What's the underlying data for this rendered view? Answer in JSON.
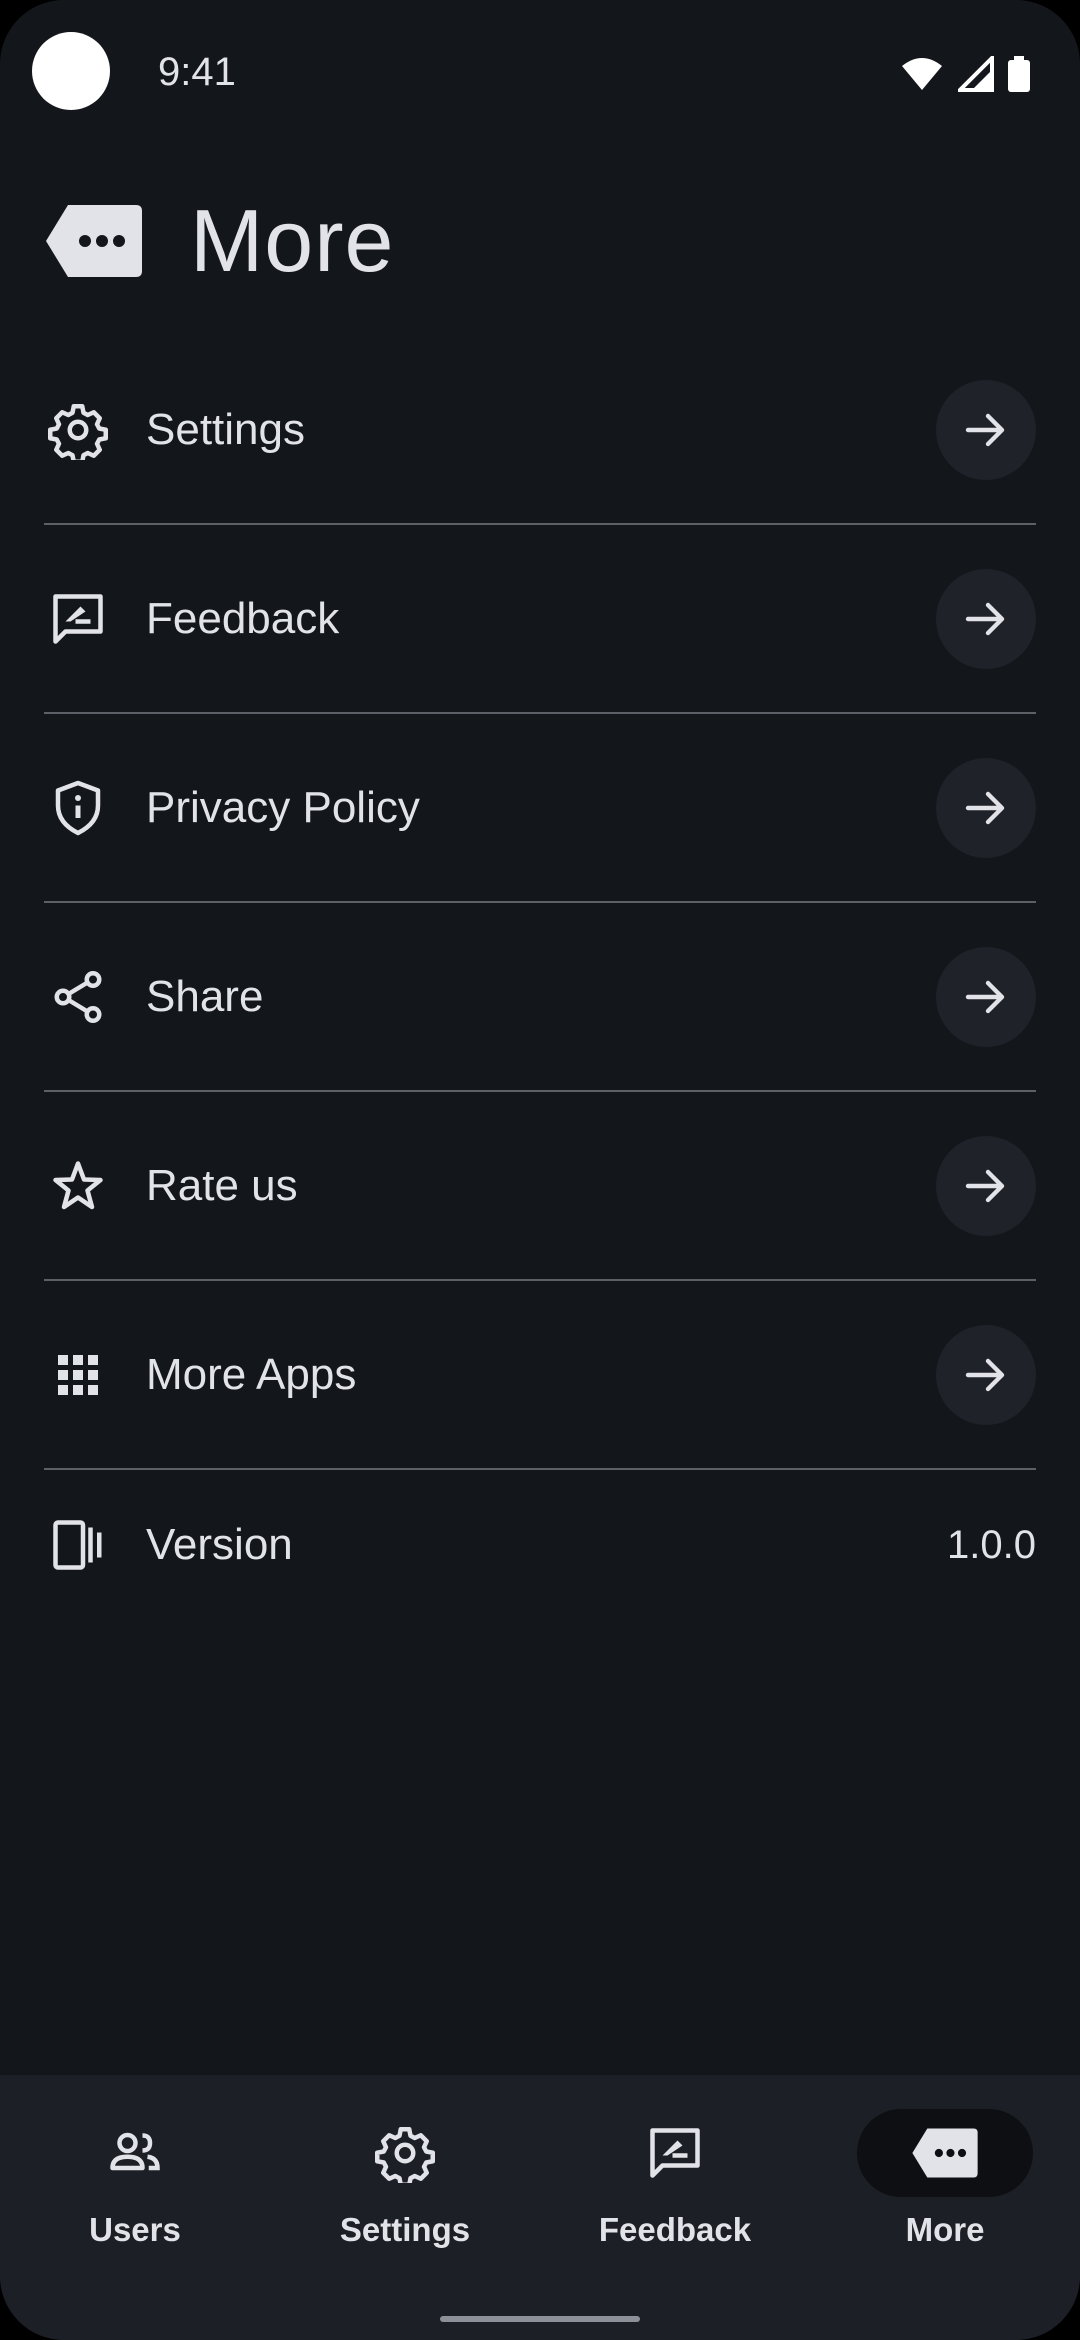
{
  "status_bar": {
    "time": "9:41"
  },
  "header": {
    "title": "More",
    "icon": "more-tag-icon"
  },
  "menu": {
    "items": [
      {
        "label": "Settings",
        "icon": "gear-icon"
      },
      {
        "label": "Feedback",
        "icon": "feedback-icon"
      },
      {
        "label": "Privacy Policy",
        "icon": "shield-info-icon"
      },
      {
        "label": "Share",
        "icon": "share-icon"
      },
      {
        "label": "Rate us",
        "icon": "star-outline-icon"
      },
      {
        "label": "More Apps",
        "icon": "apps-grid-icon"
      }
    ],
    "version": {
      "label": "Version",
      "value": "1.0.0",
      "icon": "device-version-icon"
    }
  },
  "bottom_nav": {
    "items": [
      {
        "label": "Users",
        "icon": "users-icon"
      },
      {
        "label": "Settings",
        "icon": "gear-icon"
      },
      {
        "label": "Feedback",
        "icon": "feedback-icon"
      },
      {
        "label": "More",
        "icon": "more-tag-icon",
        "active": true
      }
    ]
  },
  "colors": {
    "background": "#13161b",
    "nav_background": "#1c1f25",
    "text": "#e2e3e8",
    "divider": "#5d6067",
    "arrow_button": "#1f2228"
  }
}
